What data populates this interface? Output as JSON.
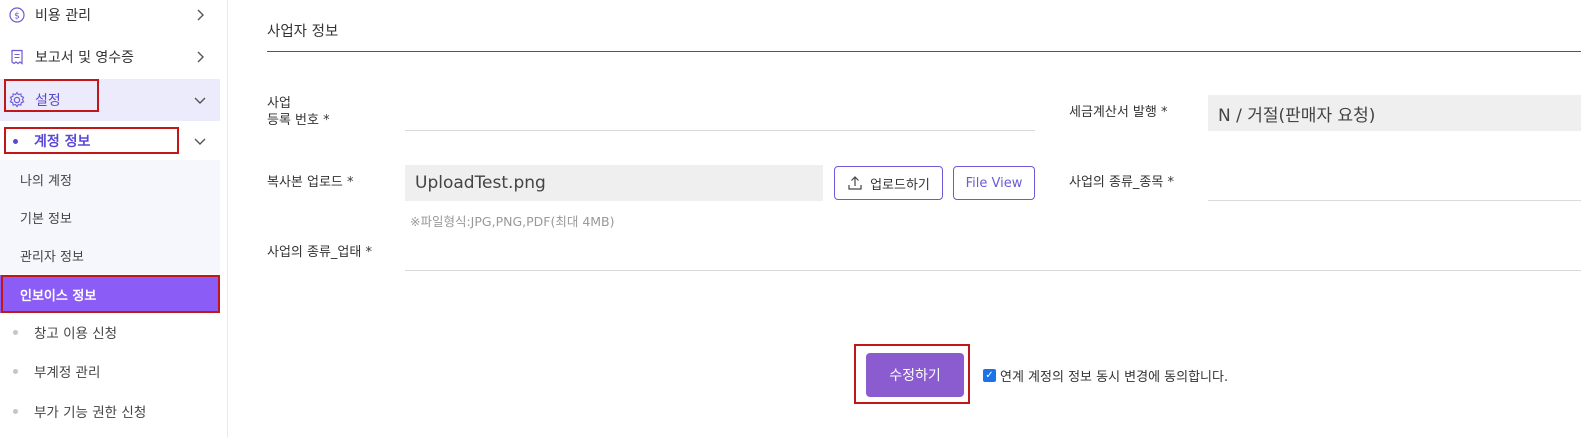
{
  "sidebar": {
    "cost_label": "비용 관리",
    "reports_label": "보고서 및 영수증",
    "settings_label": "설정",
    "account_label": "계정 정보",
    "sub_items": [
      {
        "label": "나의 계정"
      },
      {
        "label": "기본 정보"
      },
      {
        "label": "관리자 정보"
      },
      {
        "label": "인보이스 정보"
      }
    ],
    "dot_items": [
      {
        "label": "창고 이용 신청"
      },
      {
        "label": "부계정 관리"
      },
      {
        "label": "부가 기능 권한 신청"
      }
    ]
  },
  "main": {
    "section_title": "사업자 정보",
    "biz_number_label_line1": "사업",
    "biz_number_label_line2": "등록 번호 *",
    "tax_invoice_label": "세금계산서 발행 *",
    "tax_invoice_value": "N / 거절(판매자 요청)",
    "copy_upload_label": "복사본 업로드 *",
    "upload_file_value": "UploadTest.png",
    "upload_button": "업로드하기",
    "file_view_button": "File View",
    "file_hint": "※파일형식:JPG,PNG,PDF(최대 4MB)",
    "biz_item_label": "사업의 종류_종목 *",
    "biz_type_label": "사업의 종류_업태 *",
    "submit_button": "수정하기",
    "agree_text": "연계 계정의 정보 동시 변경에 동의합니다."
  },
  "colors": {
    "accent": "#8b5cf6",
    "submit_bg": "#8a5ccf",
    "highlight_box": "#c01818"
  }
}
